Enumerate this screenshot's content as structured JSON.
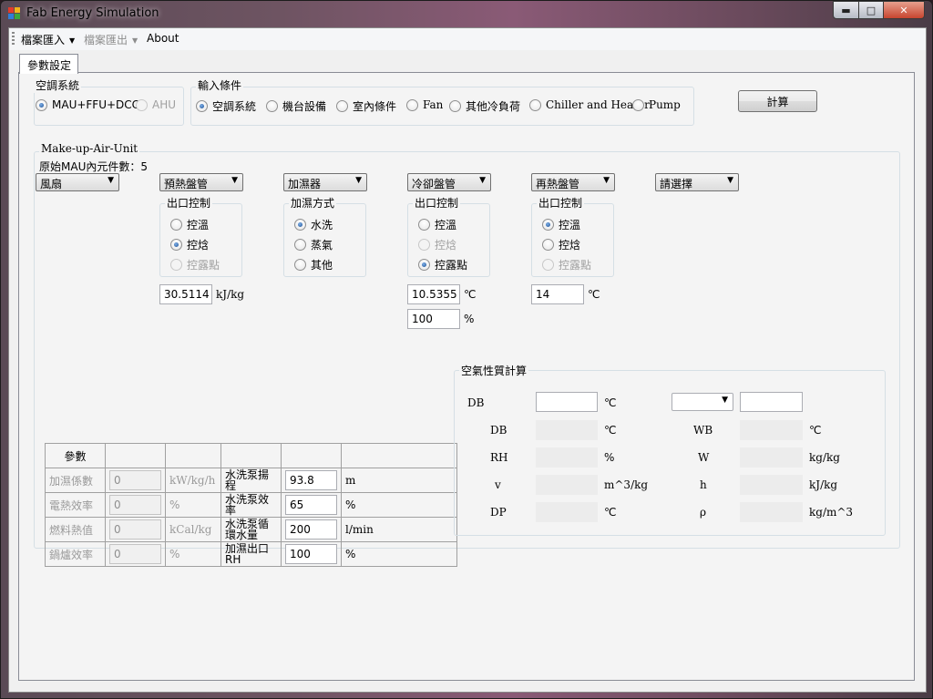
{
  "window": {
    "title": "Fab Energy Simulation",
    "min_glyph": "▬",
    "max_glyph": "□",
    "close_glyph": "✕"
  },
  "menu": {
    "import": "檔案匯入",
    "export": "檔案匯出",
    "about": "About"
  },
  "tab": {
    "label": "參數設定"
  },
  "aircon_group": {
    "title": "空調系統",
    "options": [
      "MAU+FFU+DCC",
      "AHU"
    ]
  },
  "input_group": {
    "title": "輸入條件",
    "options": [
      "空調系統",
      "機台設備",
      "室內條件",
      "Fan",
      "其他冷負荷",
      "Chiller and Heater",
      "Pump"
    ]
  },
  "calc_button": "計算",
  "mau": {
    "title": "Make-up-Air-Unit",
    "count_label": "原始MAU內元件數：5",
    "combos": [
      "風扇",
      "預熱盤管",
      "加濕器",
      "冷卻盤管",
      "再熱盤管",
      "請選擇"
    ],
    "preheat": {
      "title": "出口控制",
      "options": [
        "控溫",
        "控焓",
        "控露點"
      ],
      "value": "30.5114",
      "unit": "kJ/kg"
    },
    "humidifier": {
      "title": "加濕方式",
      "options": [
        "水洗",
        "蒸氣",
        "其他"
      ]
    },
    "cooling": {
      "title": "出口控制",
      "options": [
        "控溫",
        "控焓",
        "控露點"
      ],
      "value1": "10.5355",
      "unit1": "℃",
      "value2": "100",
      "unit2": "%"
    },
    "reheat": {
      "title": "出口控制",
      "options": [
        "控溫",
        "控焓",
        "控露點"
      ],
      "value": "14",
      "unit": "℃"
    }
  },
  "params": {
    "header": "參數",
    "rows": [
      {
        "label": "加濕係數",
        "value": "0",
        "unit": "kW/kg/h",
        "label2": "水洗泵揚程",
        "value2": "93.8",
        "unit2": "m"
      },
      {
        "label": "電熱效率",
        "value": "0",
        "unit": "%",
        "label2": "水洗泵效率",
        "value2": "65",
        "unit2": "%"
      },
      {
        "label": "燃料熱值",
        "value": "0",
        "unit": "kCal/kg",
        "label2": "水洗泵循環水量",
        "value2": "200",
        "unit2": "l/min"
      },
      {
        "label": "鍋爐效率",
        "value": "0",
        "unit": "%",
        "label2": "加濕出口RH",
        "value2": "100",
        "unit2": "%"
      }
    ]
  },
  "air": {
    "title": "空氣性質計算",
    "db_label": "DB",
    "db_unit": "℃",
    "left": [
      {
        "label": "DB",
        "unit": "℃"
      },
      {
        "label": "RH",
        "unit": "%"
      },
      {
        "label": "v",
        "unit": "m^3/kg"
      },
      {
        "label": "DP",
        "unit": "℃"
      }
    ],
    "right": [
      {
        "label": "WB",
        "unit": "℃"
      },
      {
        "label": "W",
        "unit": "kg/kg"
      },
      {
        "label": "h",
        "unit": "kJ/kg"
      },
      {
        "label": "ρ",
        "unit": "kg/m^3"
      }
    ]
  }
}
